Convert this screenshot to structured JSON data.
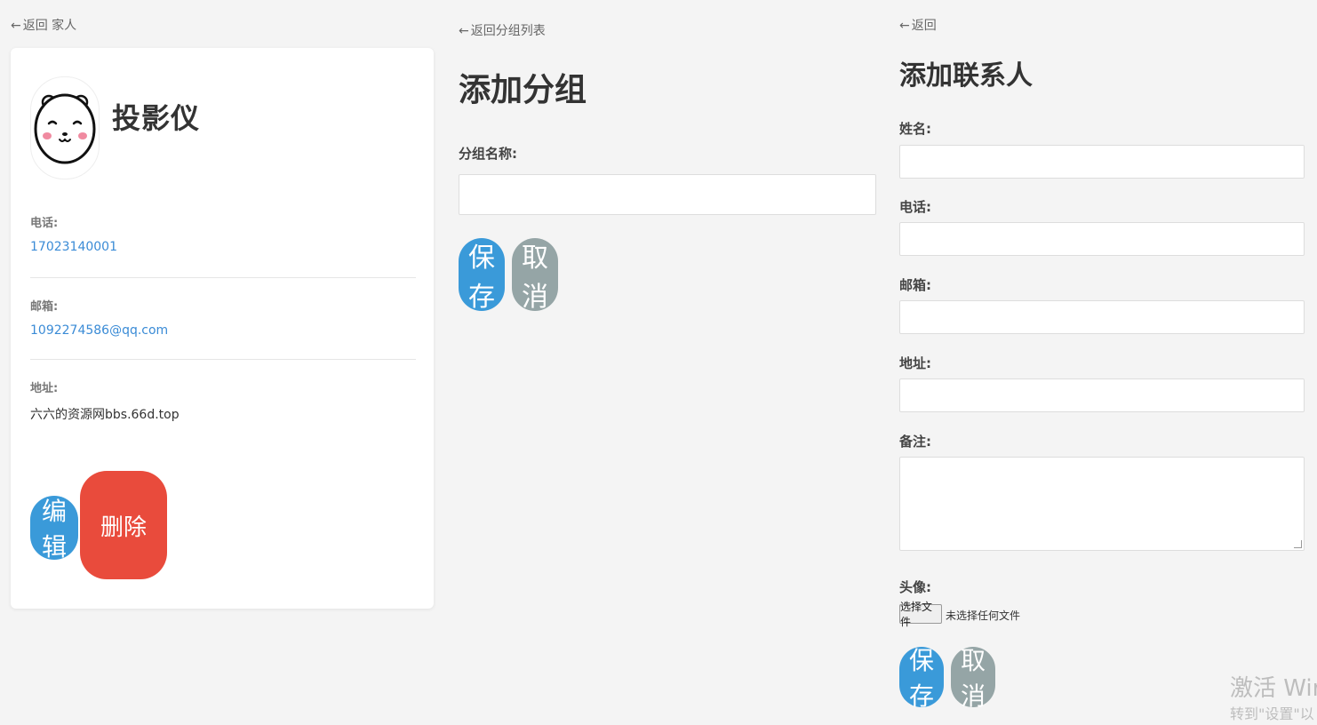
{
  "contact_detail": {
    "back_label": "返回 家人",
    "back_arrow": "←",
    "name": "投影仪",
    "phone_label": "电话:",
    "phone_value": "17023140001",
    "email_label": "邮箱:",
    "email_value": "1092274586@qq.com",
    "address_label": "地址:",
    "address_value": "六六的资源网bbs.66d.top",
    "edit_button": "编辑",
    "delete_button": "删除",
    "avatar_icon": "bear-face-icon"
  },
  "add_group": {
    "back_label": "返回分组列表",
    "back_arrow": "←",
    "title": "添加分组",
    "group_name_label": "分组名称:",
    "save_button": "保存",
    "cancel_button": "取消"
  },
  "add_contact": {
    "back_label": "返回",
    "back_arrow": "←",
    "title": "添加联系人",
    "name_label": "姓名:",
    "phone_label": "电话:",
    "email_label": "邮箱:",
    "address_label": "地址:",
    "note_label": "备注:",
    "avatar_label": "头像:",
    "choose_file_button": "选择文件",
    "no_file_text": "未选择任何文件",
    "save_button": "保存",
    "cancel_button": "取消"
  },
  "watermark": {
    "line1": "激活 Wir",
    "line2": "转到\"设置\"以"
  },
  "colors": {
    "primary_blue": "#3a9ad9",
    "danger_red": "#e94b3c",
    "muted_gray": "#95a5a6",
    "link_blue": "#3a8bd6",
    "background": "#f4f4f4"
  }
}
